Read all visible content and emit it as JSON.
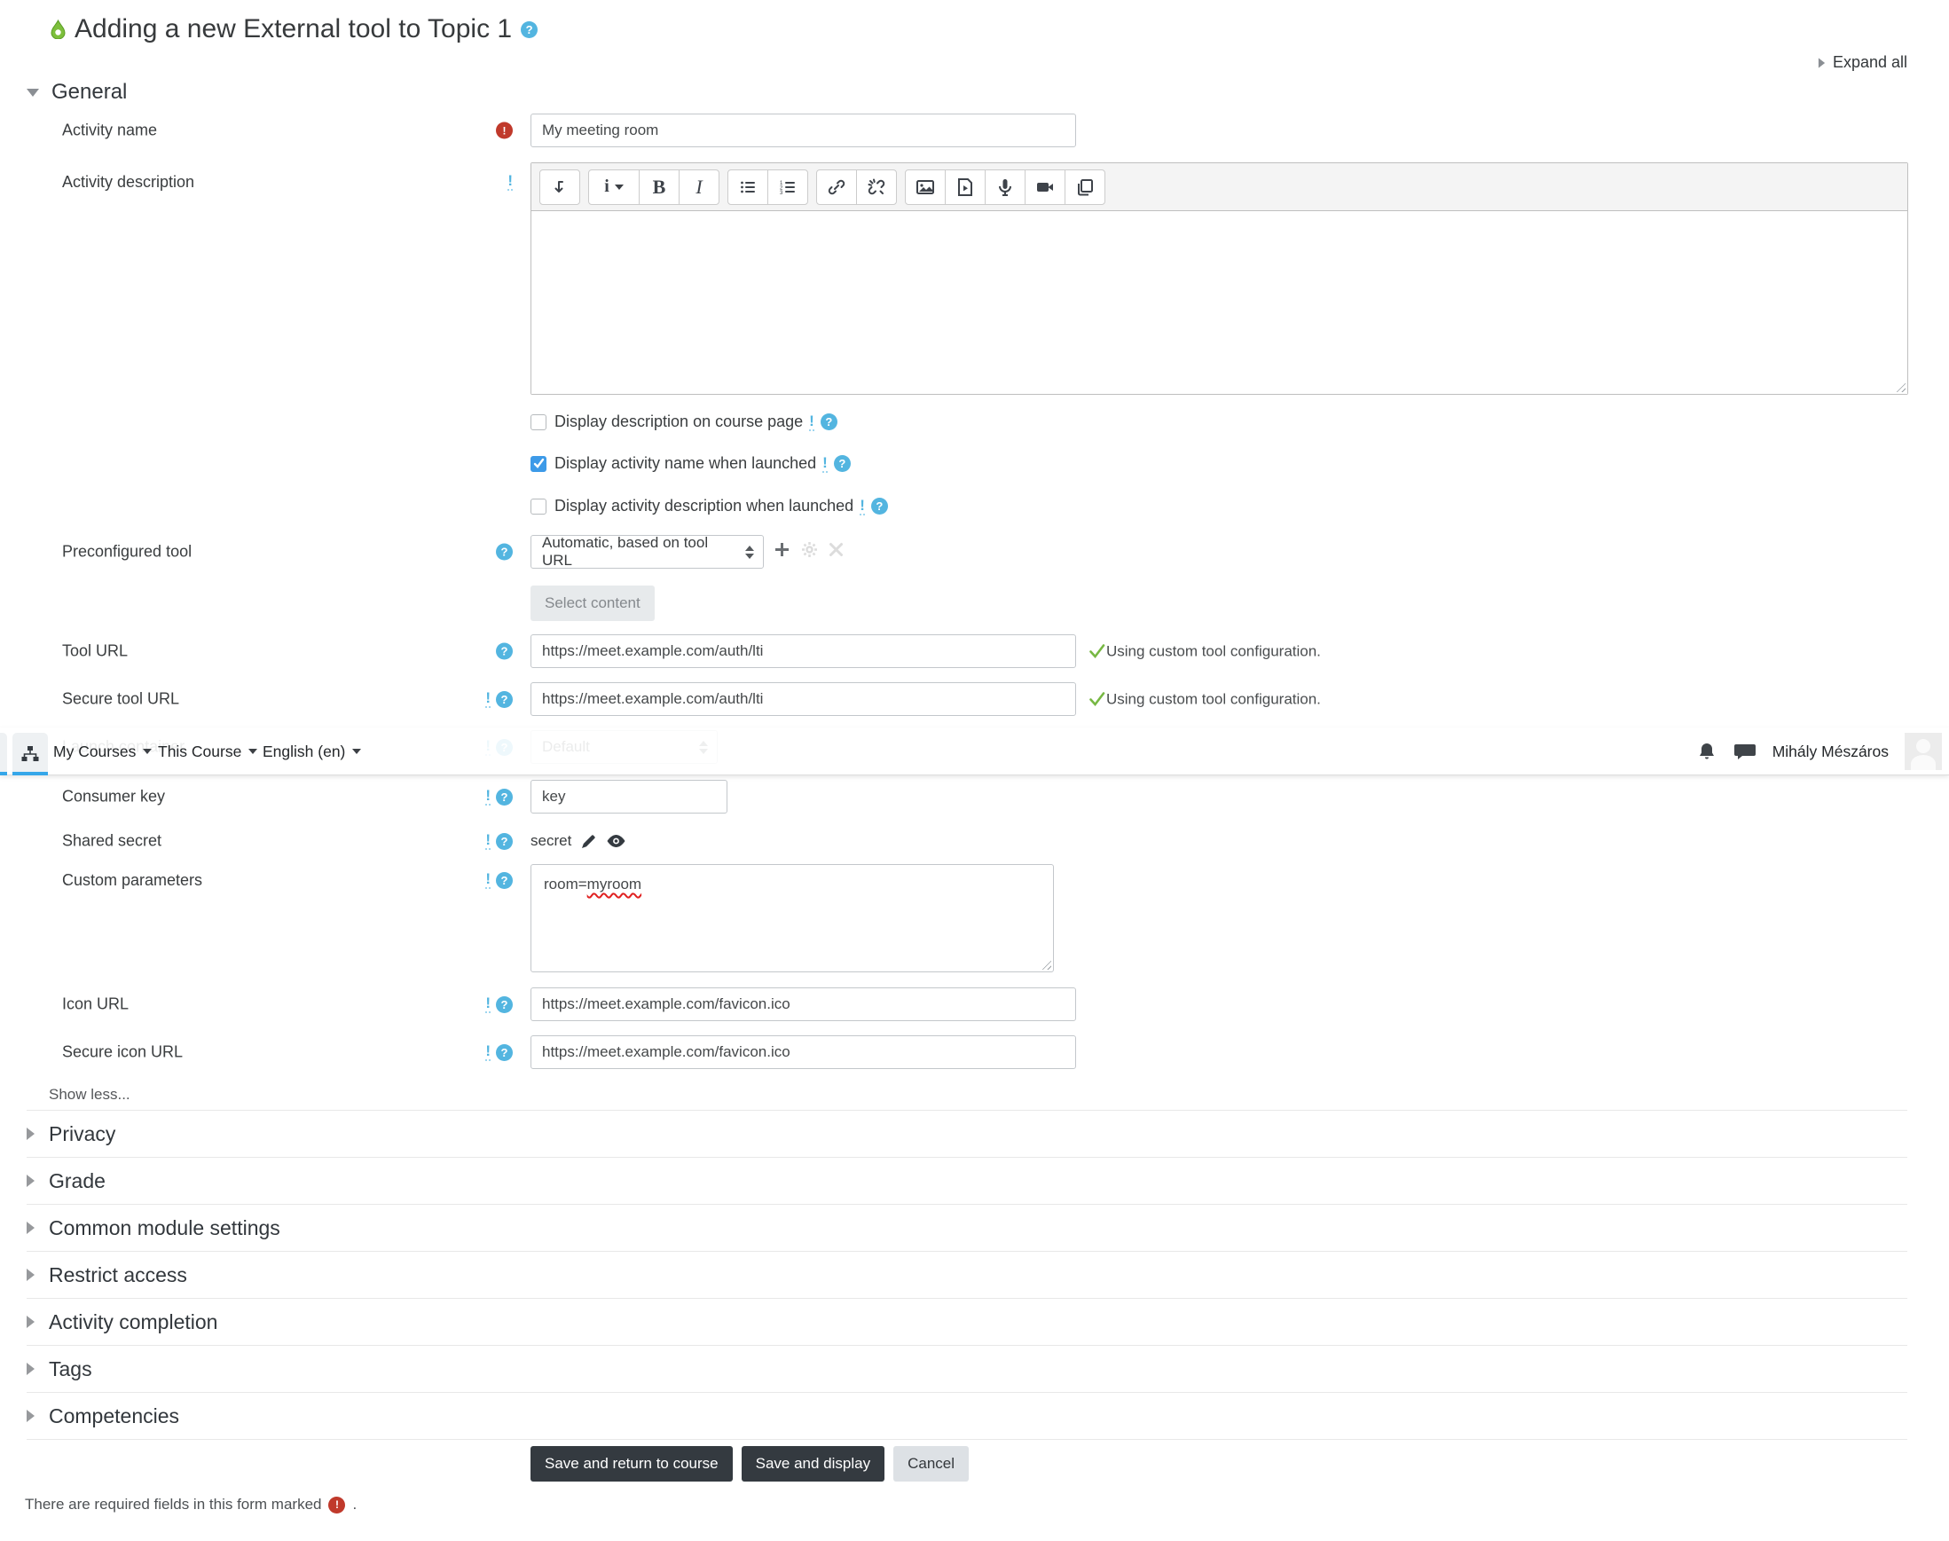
{
  "page": {
    "title": "Adding a new External tool to Topic 1",
    "expand_all": "Expand all",
    "required_note_prefix": "There are required fields in this form marked",
    "required_note_suffix": ".",
    "help_glyph": "?",
    "required_glyph": "!",
    "advanced_glyph": "!"
  },
  "navbar": {
    "menus": [
      {
        "label": "My Courses"
      },
      {
        "label": "This Course"
      },
      {
        "label": "English (en)"
      }
    ],
    "user_name": "Mihály Mészáros",
    "icons": [
      "sitemap-icon",
      "bell-icon",
      "messages-icon",
      "avatar"
    ]
  },
  "general": {
    "heading": "General",
    "activity_name": {
      "label": "Activity name",
      "value": "My meeting room"
    },
    "activity_description": {
      "label": "Activity description"
    },
    "editor_toolbar": {
      "styles_glyph": "i",
      "bold_glyph": "B",
      "italic_glyph": "I",
      "buttons": [
        "collapse-toolbar",
        "paragraph-styles",
        "bold",
        "italic",
        "unordered-list",
        "ordered-list",
        "insert-link",
        "unlink",
        "insert-image",
        "insert-media",
        "record-audio",
        "record-video",
        "manage-files"
      ]
    },
    "checkboxes": [
      {
        "label": "Display description on course page",
        "checked": false
      },
      {
        "label": "Display activity name when launched",
        "checked": true
      },
      {
        "label": "Display activity description when launched",
        "checked": false
      }
    ],
    "preconfigured_tool": {
      "label": "Preconfigured tool",
      "value": "Automatic, based on tool URL",
      "select_content_label": "Select content"
    },
    "tool_url": {
      "label": "Tool URL",
      "value": "https://meet.example.com/auth/lti",
      "status": "Using custom tool configuration."
    },
    "secure_tool_url": {
      "label": "Secure tool URL",
      "value": "https://meet.example.com/auth/lti",
      "status": "Using custom tool configuration."
    },
    "launch_container": {
      "label": "Launch container",
      "value": "Default"
    },
    "consumer_key": {
      "label": "Consumer key",
      "value": "key"
    },
    "shared_secret": {
      "label": "Shared secret",
      "value": "secret"
    },
    "custom_parameters": {
      "label": "Custom parameters",
      "value_prefix": "room=",
      "value_word": "myroom"
    },
    "icon_url": {
      "label": "Icon URL",
      "value": "https://meet.example.com/favicon.ico"
    },
    "secure_icon_url": {
      "label": "Secure icon URL",
      "value": "https://meet.example.com/favicon.ico"
    },
    "show_less": "Show less..."
  },
  "sections": [
    {
      "label": "Privacy"
    },
    {
      "label": "Grade"
    },
    {
      "label": "Common module settings"
    },
    {
      "label": "Restrict access"
    },
    {
      "label": "Activity completion"
    },
    {
      "label": "Tags"
    },
    {
      "label": "Competencies"
    }
  ],
  "buttons": {
    "save_return": "Save and return to course",
    "save_display": "Save and display",
    "cancel": "Cancel"
  },
  "colors": {
    "help_icon": "#53b5e0",
    "required_icon": "#c0392b",
    "success_check": "#77b843",
    "checkbox_checked": "#3d9ae8",
    "nav_active_bar": "#36a7e9",
    "button_dark": "#343a40"
  }
}
